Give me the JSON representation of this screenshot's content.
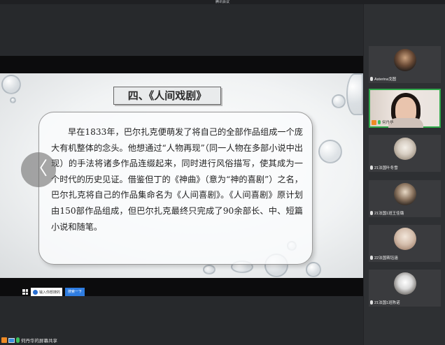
{
  "meeting": {
    "title": "腾讯会议"
  },
  "slide": {
    "title": "四、《人间戏剧》",
    "paragraph": "早在1833年，巴尔扎克便萌发了将自己的全部作品组成一个庞大有机整体的念头。他想通过“人物再现”（同一人物在多部小说中出现）的手法将诸多作品连缀起来，同时进行风俗描写，使其成为一个时代的历史见证。借鉴但丁的《神曲》（意为“神的喜剧”）之名，巴尔扎克将自己的作品集命名为《人间喜剧》。《人间喜剧》原计划由150部作品组成，但巴尔扎克最终只完成了90余部长、中、短篇小说和随笔。",
    "prev_icon": "chevron-left-icon",
    "prev_glyph": "〈"
  },
  "taskbar": {
    "search_placeholder": "输入你想搜的",
    "search_button": "搜索一下"
  },
  "status": {
    "sharing_text": "何丹华的屏幕共享"
  },
  "participants": [
    {
      "name": "Asterina戈图",
      "avatar": "photo-avatar",
      "active": false
    },
    {
      "name": "何丹华",
      "avatar": "camera-video",
      "active": true
    },
    {
      "name": "21法国叶冬雪",
      "avatar": "photo-avatar",
      "active": false
    },
    {
      "name": "21法国1班王佳璐",
      "avatar": "photo-avatar",
      "active": false
    },
    {
      "name": "22法国蒋钰涵",
      "avatar": "photo-avatar",
      "active": false
    },
    {
      "name": "21法国1班陈诺",
      "avatar": "photo-avatar",
      "active": false
    }
  ],
  "colors": {
    "active_border": "#2fa84a",
    "search_button": "#2f7de1",
    "sidebar_bg": "#2e3033"
  }
}
